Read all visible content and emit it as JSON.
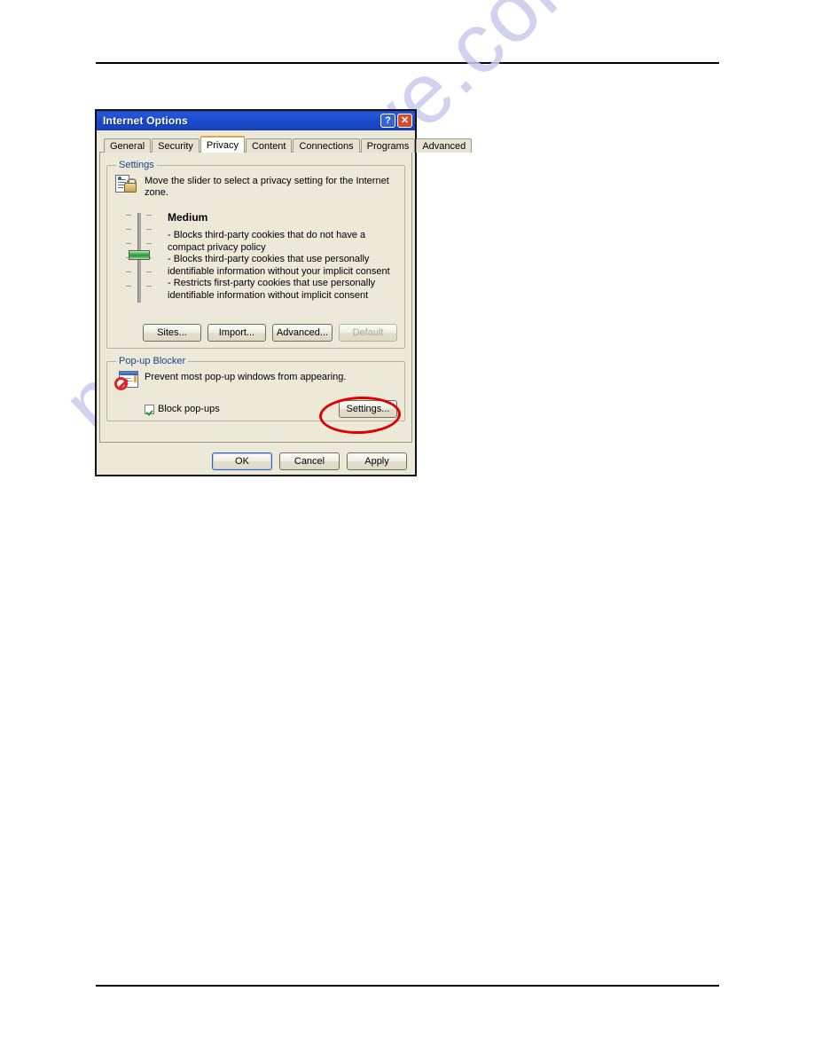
{
  "page": {
    "watermark": "manualshive.com",
    "watermark_color": "#c9c9ee"
  },
  "dialog": {
    "title": "Internet Options",
    "titlebar_color": "#1b49cc",
    "help_button": "?",
    "close_button": "✕",
    "tabs": [
      {
        "label": "General",
        "active": false
      },
      {
        "label": "Security",
        "active": false
      },
      {
        "label": "Privacy",
        "active": true
      },
      {
        "label": "Content",
        "active": false
      },
      {
        "label": "Connections",
        "active": false
      },
      {
        "label": "Programs",
        "active": false
      },
      {
        "label": "Advanced",
        "active": false
      }
    ],
    "active_tab_accent": "#e8a33d",
    "settings": {
      "legend": "Settings",
      "description": "Move the slider to select a privacy setting for the Internet zone.",
      "icon": "privacy-document-lock-icon",
      "slider": {
        "name": "privacy-level-slider",
        "value": "Medium",
        "thumb_color": "#3fae46",
        "tick_count": 6
      },
      "level_name": "Medium",
      "level_bullets": [
        "- Blocks third-party cookies that do not have a compact privacy policy",
        "- Blocks third-party cookies that use personally identifiable information without your implicit consent",
        "- Restricts first-party cookies that use personally identifiable information without implicit consent"
      ],
      "buttons": [
        {
          "label": "Sites...",
          "disabled": false
        },
        {
          "label": "Import...",
          "disabled": false
        },
        {
          "label": "Advanced...",
          "disabled": false
        },
        {
          "label": "Default",
          "disabled": true
        }
      ]
    },
    "popup_blocker": {
      "legend": "Pop-up Blocker",
      "description": "Prevent most pop-up windows from appearing.",
      "icon": "popup-blocked-icon",
      "checkbox": {
        "label": "Block pop-ups",
        "checked": true
      },
      "settings_button": "Settings..."
    },
    "footer_buttons": [
      {
        "label": "OK",
        "default": true
      },
      {
        "label": "Cancel",
        "default": false
      },
      {
        "label": "Apply",
        "default": false
      }
    ]
  },
  "annotation": {
    "shape": "ellipse",
    "color": "#e00000",
    "targets": "Settings... button in Pop-up Blocker"
  }
}
